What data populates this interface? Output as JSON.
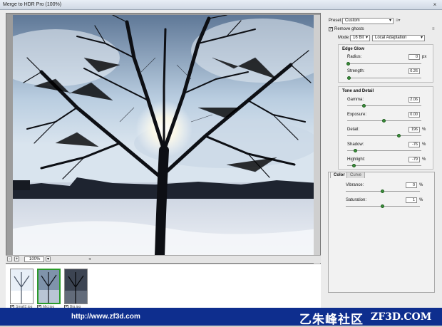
{
  "window": {
    "title": "Merge to HDR Pro (100%)",
    "close": "×"
  },
  "preview": {
    "zoom": "100%"
  },
  "thumbnails": [
    {
      "label": "Small2.jpg",
      "checked": true
    },
    {
      "label": "Mid.jpg",
      "checked": true
    },
    {
      "label": "Big.jpg",
      "checked": true
    }
  ],
  "panel": {
    "preset_label": "Preset:",
    "preset_value": "Custom",
    "remove_ghosts": "Remove ghosts",
    "mode_label": "Mode:",
    "mode_bits": "16 Bit",
    "mode_method": "Local Adaptation",
    "edge_glow": {
      "title": "Edge Glow",
      "radius": {
        "label": "Radius:",
        "value": "0",
        "unit": "px",
        "level": 0.02
      },
      "strength": {
        "label": "Strength:",
        "value": "0.26",
        "level": 0.03
      }
    },
    "tone_detail": {
      "title": "Tone and Detail",
      "gamma": {
        "label": "Gamma:",
        "value": "2.06",
        "level": 0.23
      },
      "exposure": {
        "label": "Exposure:",
        "value": "0.00",
        "level": 0.5
      },
      "detail": {
        "label": "Detail:",
        "value": "196",
        "unit": "%",
        "level": 0.7
      },
      "shadow": {
        "label": "Shadow:",
        "value": "-76",
        "unit": "%",
        "level": 0.12
      },
      "highlight": {
        "label": "Highlight:",
        "value": "-79",
        "unit": "%",
        "level": 0.1
      }
    },
    "tabs": {
      "color": "Color",
      "curve": "Curve"
    },
    "color": {
      "vibrance": {
        "label": "Vibrance:",
        "value": "0",
        "unit": "%",
        "level": 0.5
      },
      "saturation": {
        "label": "Saturation:",
        "value": "1",
        "unit": "%",
        "level": 0.5
      }
    }
  },
  "banner": {
    "url": "http://www.zf3d.com",
    "cn": "乙朱峰社区",
    "brand": "ZF3D.COM"
  }
}
